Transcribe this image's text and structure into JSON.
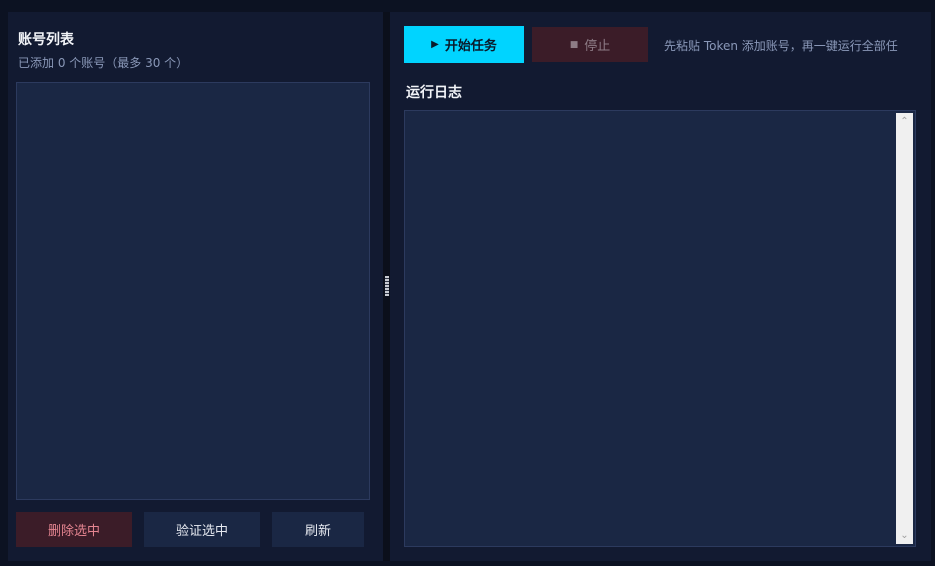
{
  "accounts": {
    "title": "账号列表",
    "subtitle": "已添加 0 个账号（最多 30 个）",
    "items": []
  },
  "actions": {
    "delete_label": "删除选中",
    "verify_label": "验证选中",
    "refresh_label": "刷新"
  },
  "toolbar": {
    "start_label": "开始任务",
    "start_icon": "play-icon",
    "stop_label": "停止",
    "stop_icon": "stop-icon",
    "hint": "先粘贴 Token 添加账号，再一键运行全部任"
  },
  "log": {
    "title": "运行日志",
    "lines": []
  },
  "colors": {
    "accent": "#00d4ff",
    "danger_bg": "#3b1c28",
    "danger_text": "#e58591",
    "panel_bg": "#121a31",
    "field_bg": "#1a2744"
  }
}
